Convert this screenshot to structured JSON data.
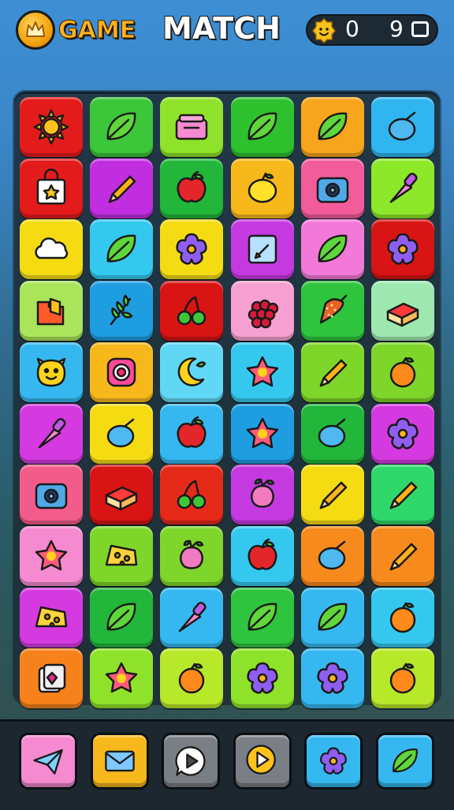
{
  "header": {
    "brand_label": "GAME",
    "title": "MATCH",
    "score": "0",
    "moves": "9"
  },
  "board": {
    "columns": 6,
    "rows": 10,
    "tiles": [
      {
        "color": "#e41b1b",
        "icon": "sun-icon"
      },
      {
        "color": "#3cc63a",
        "icon": "leaf-icon"
      },
      {
        "color": "#8fe22a",
        "icon": "gift-box-icon"
      },
      {
        "color": "#2ec12e",
        "icon": "leaf-icon"
      },
      {
        "color": "#f7a51c",
        "icon": "leaf-icon"
      },
      {
        "color": "#2fb6f0",
        "icon": "berry-icon"
      },
      {
        "color": "#e41b1b",
        "icon": "shopping-bag-icon"
      },
      {
        "color": "#c02ee0",
        "icon": "pencil-icon"
      },
      {
        "color": "#22b63a",
        "icon": "apple-icon"
      },
      {
        "color": "#f7b81c",
        "icon": "lemon-icon"
      },
      {
        "color": "#f25c9a",
        "icon": "camera-icon"
      },
      {
        "color": "#8de82a",
        "icon": "brush-icon"
      },
      {
        "color": "#f5dc12",
        "icon": "cloud-icon"
      },
      {
        "color": "#35c8ef",
        "icon": "leaf-icon"
      },
      {
        "color": "#f5dc12",
        "icon": "flower-icon"
      },
      {
        "color": "#c43ae0",
        "icon": "notepad-icon"
      },
      {
        "color": "#f279d8",
        "icon": "leaf-icon"
      },
      {
        "color": "#d81414",
        "icon": "flower-icon"
      },
      {
        "color": "#a9e45a",
        "icon": "folder-icon"
      },
      {
        "color": "#1e9de0",
        "icon": "herb-icon"
      },
      {
        "color": "#d81414",
        "icon": "cherries-icon"
      },
      {
        "color": "#f5a0d0",
        "icon": "raspberry-icon"
      },
      {
        "color": "#2fc43e",
        "icon": "strawberry-icon"
      },
      {
        "color": "#9ee8b0",
        "icon": "cake-icon"
      },
      {
        "color": "#35b8ef",
        "icon": "smiley-icon"
      },
      {
        "color": "#f7b81c",
        "icon": "target-icon"
      },
      {
        "color": "#60d8f5",
        "icon": "moon-icon"
      },
      {
        "color": "#35c8ef",
        "icon": "star-icon"
      },
      {
        "color": "#7ed62a",
        "icon": "pencil-icon"
      },
      {
        "color": "#7ed62a",
        "icon": "orange-icon"
      },
      {
        "color": "#d43ae0",
        "icon": "brush-icon"
      },
      {
        "color": "#f5dc12",
        "icon": "berry-icon"
      },
      {
        "color": "#35b8ef",
        "icon": "apple-icon"
      },
      {
        "color": "#1e9de0",
        "icon": "star-icon"
      },
      {
        "color": "#22b63a",
        "icon": "berry-icon"
      },
      {
        "color": "#d43ae0",
        "icon": "flower-icon"
      },
      {
        "color": "#f25c8a",
        "icon": "camera-icon"
      },
      {
        "color": "#d81414",
        "icon": "cake-icon"
      },
      {
        "color": "#e62a1a",
        "icon": "cherries-icon"
      },
      {
        "color": "#c43ae0",
        "icon": "radish-icon"
      },
      {
        "color": "#f5dc12",
        "icon": "pencil-icon"
      },
      {
        "color": "#2fd86a",
        "icon": "pencil-icon"
      },
      {
        "color": "#f58ad0",
        "icon": "star-icon"
      },
      {
        "color": "#7ed62a",
        "icon": "cheese-icon"
      },
      {
        "color": "#7ed62a",
        "icon": "radish-icon"
      },
      {
        "color": "#35c8ef",
        "icon": "apple-icon"
      },
      {
        "color": "#f78a1c",
        "icon": "berry-icon"
      },
      {
        "color": "#f78a1c",
        "icon": "pencil-icon"
      },
      {
        "color": "#d43ae0",
        "icon": "cheese-icon"
      },
      {
        "color": "#22b63a",
        "icon": "leaf-icon"
      },
      {
        "color": "#35b8ef",
        "icon": "brush-icon"
      },
      {
        "color": "#2fc43e",
        "icon": "leaf-icon"
      },
      {
        "color": "#35b8ef",
        "icon": "leaf-icon"
      },
      {
        "color": "#35c8ef",
        "icon": "orange-icon"
      },
      {
        "color": "#f7821c",
        "icon": "cards-icon"
      },
      {
        "color": "#8fe22a",
        "icon": "star-icon"
      },
      {
        "color": "#b8e82a",
        "icon": "orange-icon"
      },
      {
        "color": "#8fe22a",
        "icon": "flower-icon"
      },
      {
        "color": "#35b8ef",
        "icon": "flower-icon"
      },
      {
        "color": "#b8e82a",
        "icon": "orange-icon"
      }
    ]
  },
  "toolbar": {
    "buttons": [
      {
        "color": "#f58ad0",
        "icon": "paper-plane-icon"
      },
      {
        "color": "#f7b81c",
        "icon": "mail-icon"
      },
      {
        "color": "#7a7f85",
        "icon": "chat-play-icon"
      },
      {
        "color": "#7a7f85",
        "icon": "play-icon"
      },
      {
        "color": "#35b8ef",
        "icon": "flower-icon"
      },
      {
        "color": "#35b8ef",
        "icon": "leaf-icon"
      }
    ]
  }
}
